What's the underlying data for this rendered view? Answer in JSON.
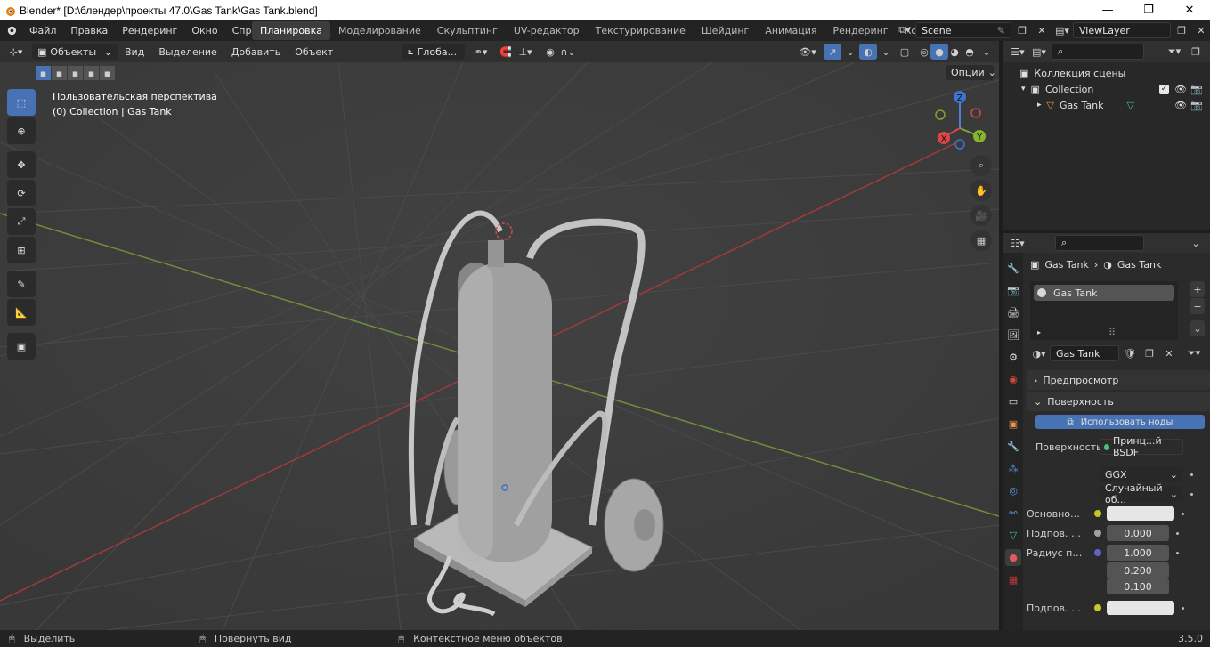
{
  "window": {
    "title": "Blender* [D:\\блендер\\проекты 47.0\\Gas Tank\\Gas Tank.blend]"
  },
  "menu": [
    "Файл",
    "Правка",
    "Рендеринг",
    "Окно",
    "Справка"
  ],
  "workspaces": [
    "Планировка",
    "Моделирование",
    "Скульптинг",
    "UV-редактор",
    "Текстурирование",
    "Шейдинг",
    "Анимация",
    "Рендеринг",
    "Композитинг"
  ],
  "scene": {
    "name": "Scene",
    "view_layer": "ViewLayer"
  },
  "viewport": {
    "mode": "Объекты",
    "menus": [
      "Вид",
      "Выделение",
      "Добавить",
      "Объект"
    ],
    "orientation": "Глоба...",
    "options_label": "Опции",
    "overlay_title": "Пользовательская перспектива",
    "overlay_subtitle": "(0) Collection | Gas Tank",
    "gizmo": {
      "x": "X",
      "y": "Y",
      "z": "Z"
    }
  },
  "outliner": {
    "scene_collection": "Коллекция сцены",
    "collection": "Collection",
    "object": "Gas Tank"
  },
  "properties": {
    "breadcrumb": [
      "Gas Tank",
      "Gas Tank"
    ],
    "slot": "Gas Tank",
    "material_name": "Gas Tank",
    "panels": {
      "preview": "Предпросмотр",
      "surface": "Поверхность"
    },
    "use_nodes": "Использовать ноды",
    "surface_label": "Поверхность",
    "surface_value": "Принц...й BSDF",
    "distribution": "GGX",
    "subsurface_method": "Случайный об...",
    "rows": [
      {
        "label": "Основной ...",
        "value": ""
      },
      {
        "label": "Подпов. р...",
        "value": "0.000"
      },
      {
        "label": "Радиус по...",
        "value": "1.000"
      },
      {
        "label": "",
        "value": "0.200"
      },
      {
        "label": "",
        "value": "0.100"
      },
      {
        "label": "Подпов. цв...",
        "value": ""
      }
    ]
  },
  "status": {
    "select": "Выделить",
    "rotate": "Повернуть вид",
    "context": "Контекстное меню объектов",
    "version": "3.5.0"
  }
}
